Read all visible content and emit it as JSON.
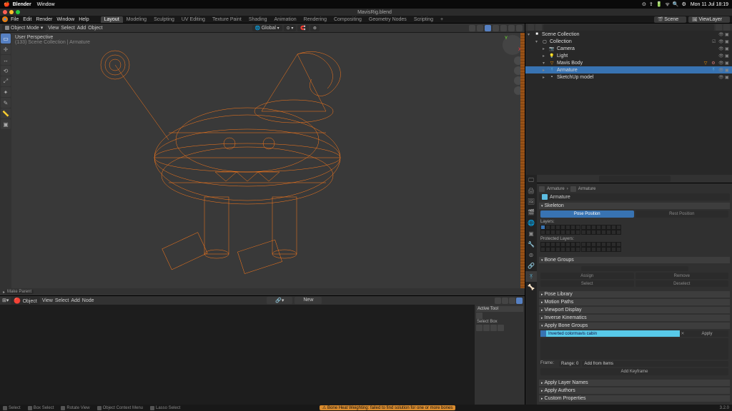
{
  "mac": {
    "app": "Blender",
    "menu": "Window",
    "clock": "Mon 11 Jul 18:19"
  },
  "window": {
    "title": "MavisRig.blend"
  },
  "bl_menu": {
    "items": [
      "File",
      "Edit",
      "Render",
      "Window",
      "Help"
    ],
    "tabs": [
      "Layout",
      "Modeling",
      "Sculpting",
      "UV Editing",
      "Texture Paint",
      "Shading",
      "Animation",
      "Rendering",
      "Compositing",
      "Geometry Nodes",
      "Scripting",
      "+"
    ],
    "active_tab": "Layout",
    "scene": "Scene",
    "viewlayer": "ViewLayer"
  },
  "viewport": {
    "mode": "Object Mode",
    "menu": [
      "View",
      "Select",
      "Add",
      "Object"
    ],
    "global": "Global",
    "info_line1": "User Perspective",
    "info_line2": "(133) Scene Collection | Armature",
    "make_parent": "Make Parent"
  },
  "node_editor": {
    "menu": [
      "View",
      "Select",
      "Add",
      "Node"
    ],
    "selector": "Object",
    "new_btn": "New",
    "npanel_title": "Active Tool",
    "npanel_row": "Select Box"
  },
  "outliner": {
    "rows": [
      {
        "depth": 0,
        "icon": "scene",
        "name": "Scene Collection",
        "sel": false,
        "expand": "▾"
      },
      {
        "depth": 1,
        "icon": "coll",
        "name": "Collection",
        "sel": false,
        "expand": "▾"
      },
      {
        "depth": 2,
        "icon": "cam",
        "name": "Camera",
        "sel": false,
        "expand": "▸"
      },
      {
        "depth": 2,
        "icon": "light",
        "name": "Light",
        "sel": false,
        "expand": "▸"
      },
      {
        "depth": 2,
        "icon": "mesh",
        "name": "Mavis Body",
        "sel": false,
        "expand": "▾"
      },
      {
        "depth": 2,
        "icon": "arm",
        "name": "Armature",
        "sel": true,
        "expand": "▸"
      },
      {
        "depth": 2,
        "icon": "mesh",
        "name": "SketchUp model",
        "sel": false,
        "expand": "▸"
      }
    ]
  },
  "properties": {
    "breadcrumb": [
      "Armature",
      "Armature"
    ],
    "name_field": "Armature",
    "panels": {
      "skeleton": "Skeleton",
      "pose_position": "Pose Position",
      "rest_position": "Rest Position",
      "layers": "Layers:",
      "protected_layers": "Protected Layers:",
      "bone_groups": "Bone Groups",
      "bg_select": "Select",
      "bg_deselect": "Deselect",
      "bg_assign": "Assign",
      "bg_remove": "Remove",
      "pose_library": "Pose Library",
      "motion_paths": "Motion Paths",
      "viewport_display": "Viewport Display",
      "ik": "Inverse Kinematics",
      "apply_bone_groups": "Apply Bone Groups",
      "apply_label": "Inverted colormavis cabin",
      "apply_btn": "Apply",
      "frame": "Frame:",
      "frame_range": "Range: 0",
      "add_from_items": "Add from Items",
      "add_keyframe": "Add Keyframe",
      "apply_layer_names": "Apply Layer Names",
      "apply_authors": "Apply Authors",
      "custom": "Custom Properties"
    }
  },
  "status": {
    "select": "Select",
    "box_select": "Box Select",
    "rotate_view": "Rotate View",
    "lasso": "Object Context Menu",
    "lasso2": "Lasso Select",
    "warning": "Bone Heat Weighting: failed to find solution for one or more bones",
    "version": "3.2.0"
  }
}
